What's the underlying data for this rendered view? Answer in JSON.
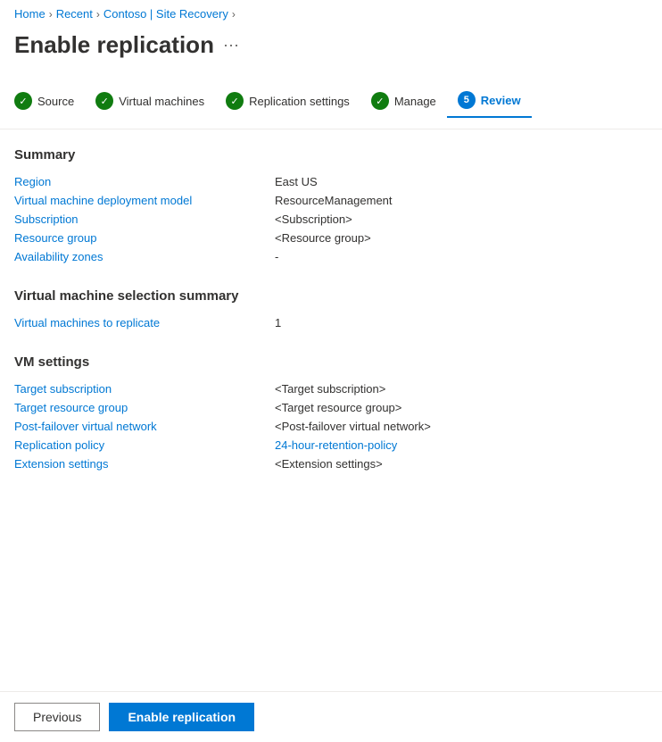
{
  "breadcrumb": {
    "items": [
      {
        "label": "Home",
        "link": true
      },
      {
        "label": "Recent",
        "link": true
      },
      {
        "label": "Contoso | Site Recovery",
        "link": true
      }
    ]
  },
  "page": {
    "title": "Enable replication",
    "more_icon": "···"
  },
  "wizard": {
    "steps": [
      {
        "label": "Source",
        "type": "check",
        "active": false
      },
      {
        "label": "Virtual machines",
        "type": "check",
        "active": false
      },
      {
        "label": "Replication settings",
        "type": "check",
        "active": false
      },
      {
        "label": "Manage",
        "type": "check",
        "active": false
      },
      {
        "label": "Review",
        "type": "number",
        "number": "5",
        "active": true
      }
    ]
  },
  "sections": {
    "summary": {
      "title": "Summary",
      "rows": [
        {
          "label": "Region",
          "value": "East US"
        },
        {
          "label": "Virtual machine deployment model",
          "value": "ResourceManagement"
        },
        {
          "label": "Subscription",
          "value": "<Subscription>"
        },
        {
          "label": "Resource group",
          "value": "<Resource group>"
        },
        {
          "label": "Availability zones",
          "value": "-"
        }
      ]
    },
    "vm_selection": {
      "title": "Virtual machine selection summary",
      "rows": [
        {
          "label": "Virtual machines to replicate",
          "value": "1"
        }
      ]
    },
    "vm_settings": {
      "title": "VM settings",
      "rows": [
        {
          "label": "Target subscription",
          "value": "<Target subscription>"
        },
        {
          "label": "Target resource group",
          "value": "<Target resource group>"
        },
        {
          "label": "Post-failover virtual network",
          "value": "<Post-failover virtual network>"
        },
        {
          "label": "Replication policy",
          "value": "24-hour-retention-policy",
          "link": true
        },
        {
          "label": "Extension settings",
          "value": "<Extension settings>"
        }
      ]
    }
  },
  "footer": {
    "previous_label": "Previous",
    "enable_label": "Enable replication"
  }
}
